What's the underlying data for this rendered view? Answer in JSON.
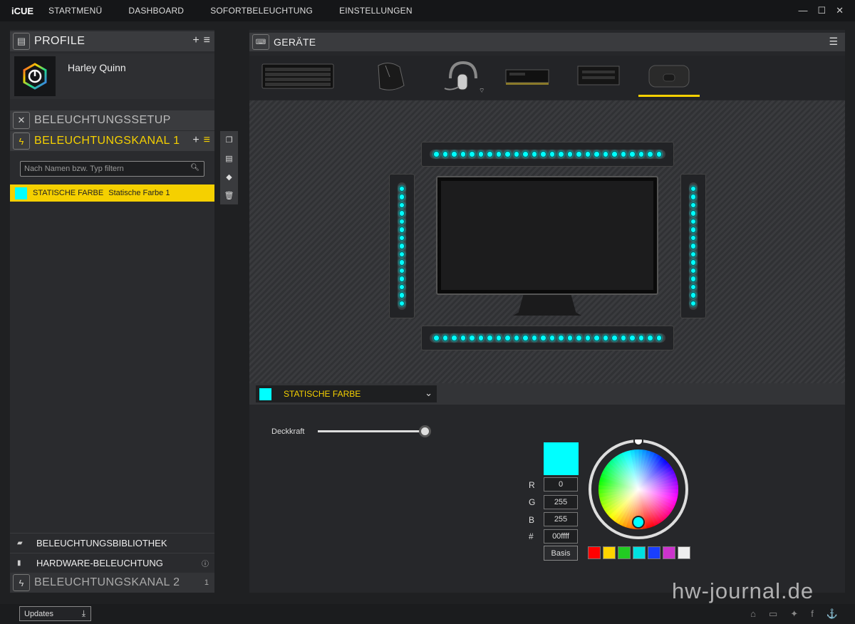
{
  "app": {
    "name": "iCUE"
  },
  "nav": [
    "STARTMENÜ",
    "DASHBOARD",
    "SOFORTBELEUCHTUNG",
    "EINSTELLUNGEN"
  ],
  "window_controls": [
    "—",
    "☐",
    "✕"
  ],
  "profile": {
    "header": "PROFILE",
    "name": "Harley Quinn"
  },
  "lighting_setup": {
    "label": "BELEUCHTUNGSSETUP"
  },
  "channel1": {
    "label": "BELEUCHTUNGSKANAL 1"
  },
  "search": {
    "placeholder": "Nach Namen bzw. Typ filtern"
  },
  "effect_item": {
    "type": "STATISCHE FARBE",
    "name": "Statische Farbe 1",
    "color": "#00ffff"
  },
  "bottom_items": [
    {
      "label": "BELEUCHTUNGSBIBLIOTHEK"
    },
    {
      "label": "HARDWARE-BELEUCHTUNG"
    }
  ],
  "channel2": {
    "label": "BELEUCHTUNGSKANAL 2",
    "count": "1"
  },
  "devices": {
    "header": "GERÄTE",
    "items": [
      "keyboard",
      "mouse",
      "headset",
      "memory",
      "controller",
      "lighting-node"
    ],
    "selected": 5
  },
  "effect_panel": {
    "selected": "STATISCHE FARBE",
    "opacity_label": "Deckkraft",
    "opacity": 1.0
  },
  "color": {
    "r": "0",
    "g": "255",
    "b": "255",
    "hex": "00ffff",
    "r_label": "R",
    "g_label": "G",
    "b_label": "B",
    "hex_label": "#",
    "basis": "Basis"
  },
  "presets": [
    "#ff0000",
    "#ffd400",
    "#22cc22",
    "#00e0e0",
    "#1a3fff",
    "#cc33cc",
    "#eeeeee"
  ],
  "watermark": "hw-journal.de",
  "updates": {
    "label": "Updates"
  }
}
